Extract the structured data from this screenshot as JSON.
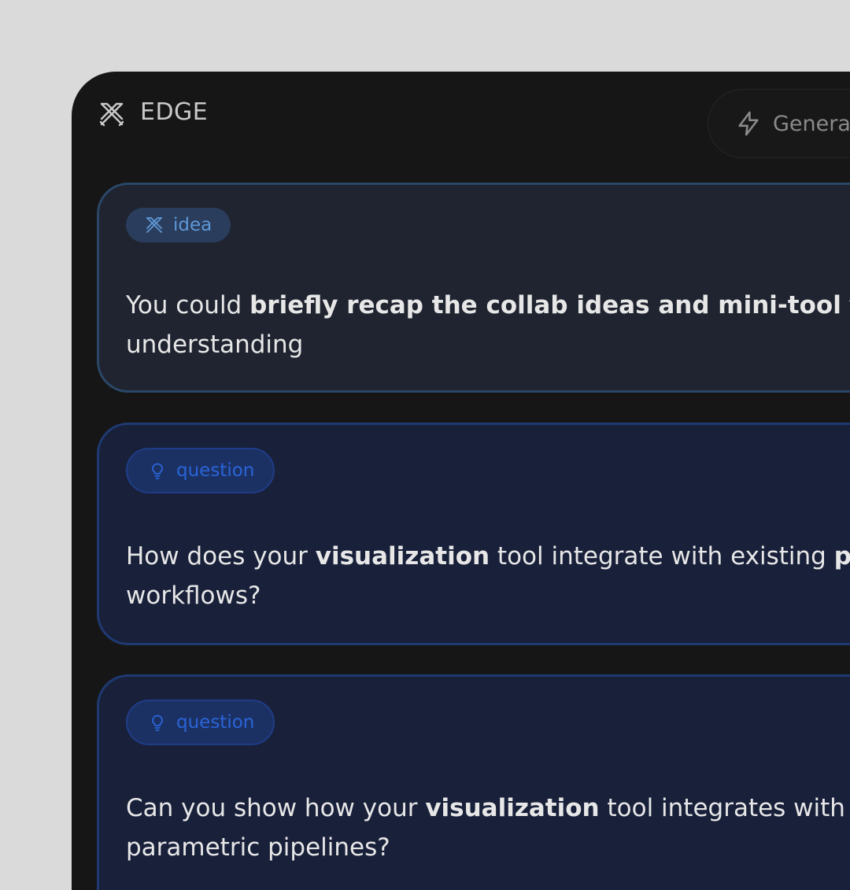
{
  "app": {
    "brand": "EDGE"
  },
  "header": {
    "generate_label": "Genera"
  },
  "cards": [
    {
      "tag": "idea",
      "line1": [
        "You could ",
        "briefly recap the collab ideas and mini-tool",
        " to"
      ],
      "line2": "understanding"
    },
    {
      "tag": "question",
      "line1": [
        "How does your ",
        "visualization",
        " tool integrate with existing ",
        "par"
      ],
      "line2": "workflows?"
    },
    {
      "tag": "question",
      "line1": [
        "Can you show how your ",
        "visualization",
        " tool integrates with e"
      ],
      "line2": "parametric pipelines?"
    }
  ],
  "colors": {
    "background": "#dadada",
    "panel": "#161616",
    "idea_accent": "#5f97d6",
    "question_accent": "#2a64d8"
  },
  "icons": [
    "edge-logo-icon",
    "lightning-icon",
    "idea-icon",
    "lightbulb-icon"
  ]
}
